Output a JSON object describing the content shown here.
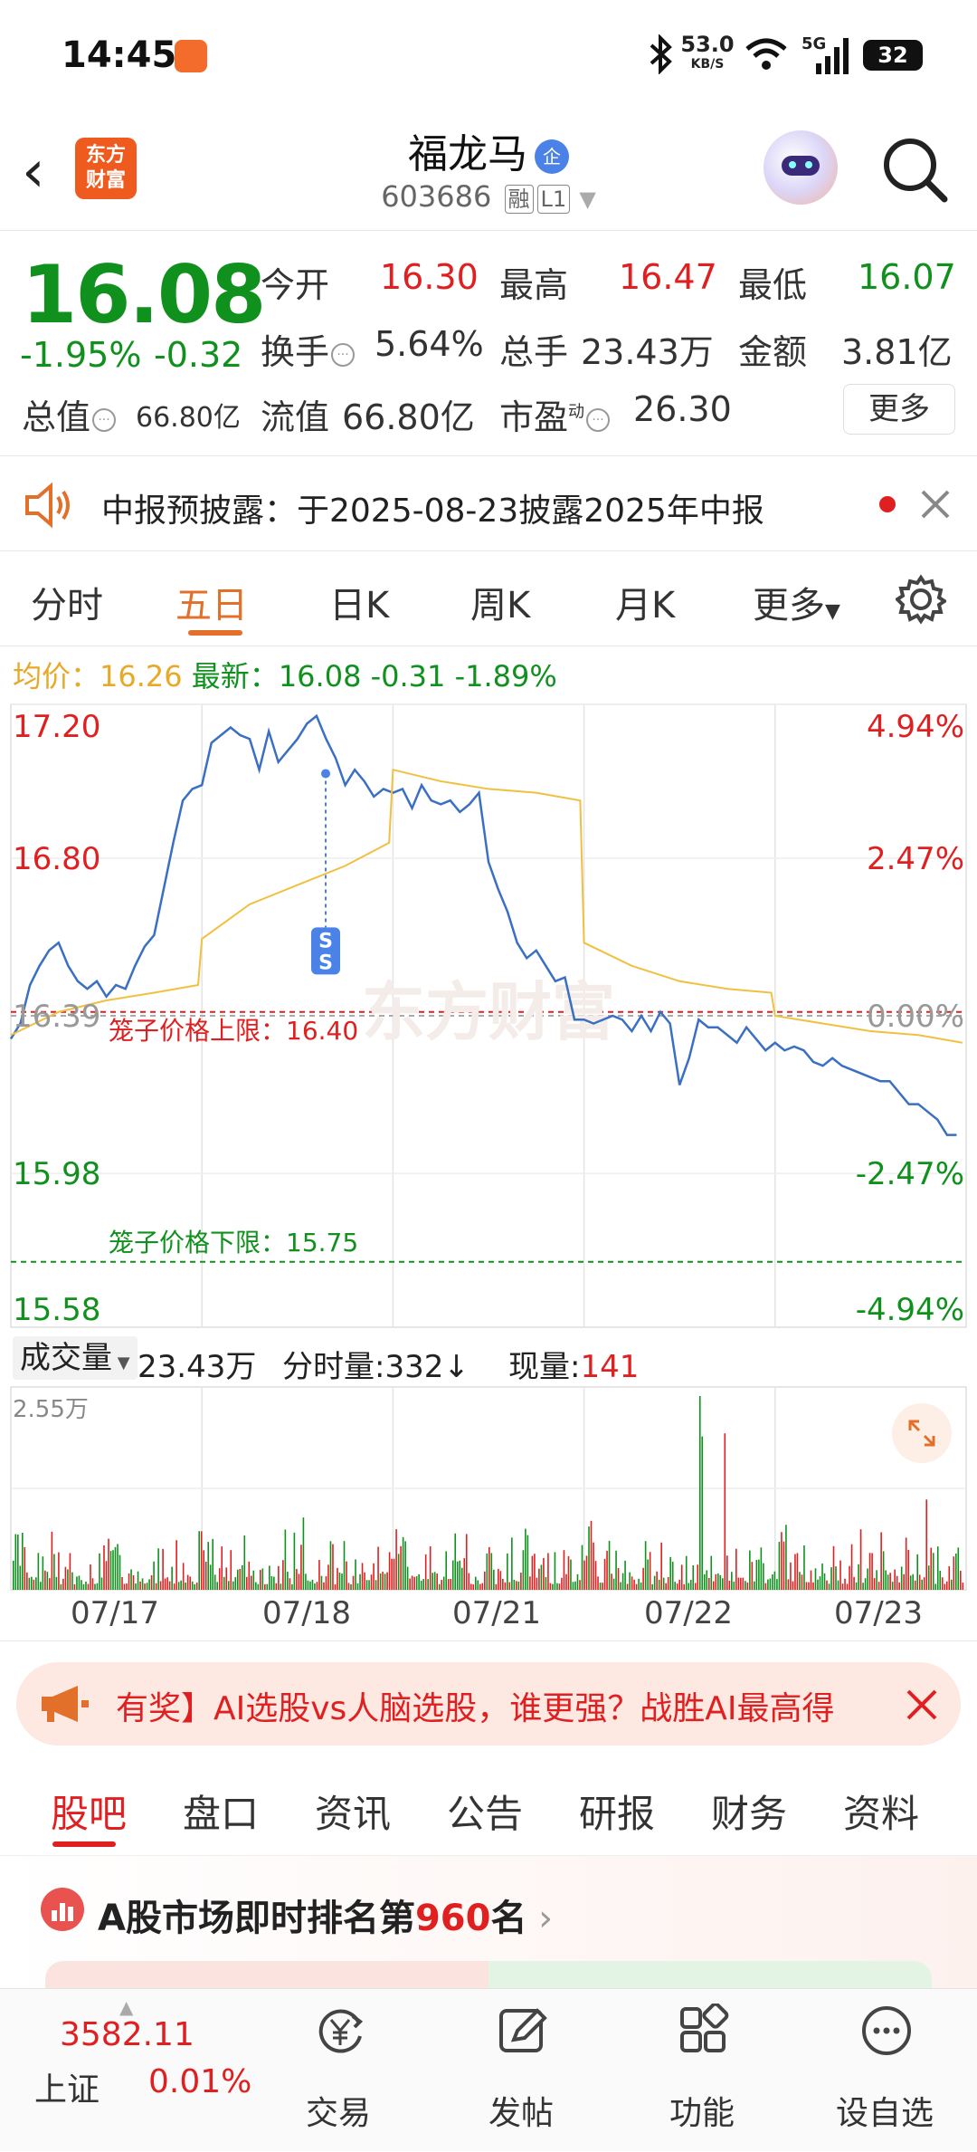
{
  "status_bar": {
    "time": "14:45",
    "net_speed_value": "53.0",
    "net_speed_unit": "KB/S",
    "network": "5G",
    "battery": "32"
  },
  "header": {
    "logo_text_line1": "东方",
    "logo_text_line2": "财富",
    "stock_name": "福龙马",
    "qi_badge": "企",
    "stock_code": "603686",
    "tag_rong": "融",
    "tag_level": "L1"
  },
  "quote": {
    "price": "16.08",
    "change_pct": "-1.95%",
    "change_amt": "-0.32",
    "open_label": "今开",
    "open_value": "16.30",
    "high_label": "最高",
    "high_value": "16.47",
    "low_label": "最低",
    "low_value": "16.07",
    "turnover_label": "换手",
    "turnover_value": "5.64%",
    "volume_label": "总手",
    "volume_value": "23.43万",
    "amount_label": "金额",
    "amount_value": "3.81亿",
    "mktcap_label": "总值",
    "mktcap_value": "66.80亿",
    "float_label": "流值",
    "float_value": "66.80亿",
    "pe_label": "市盈",
    "pe_sup": "动",
    "pe_value": "26.30",
    "more_button": "更多"
  },
  "notice": {
    "text": "中报预披露：于2025-08-23披露2025年中报"
  },
  "chart_tabs": [
    "分时",
    "五日",
    "日K",
    "周K",
    "月K",
    "更多"
  ],
  "chart_tabs_active": 1,
  "avg_line": {
    "avg_label": "均价：",
    "avg_value": "16.26",
    "latest_label": "最新：",
    "latest_value": "16.08",
    "latest_change": "-0.31",
    "latest_pct": "-1.89%"
  },
  "chart_data": {
    "type": "line",
    "title": "",
    "xlabel": "",
    "ylabel": "",
    "ylim": [
      15.58,
      17.2
    ],
    "reference_price": 16.39,
    "y_tick_labels_left": [
      "17.20",
      "16.80",
      "16.39",
      "15.98",
      "15.58"
    ],
    "y_tick_labels_right": [
      "4.94%",
      "2.47%",
      "0.00%",
      "-2.47%",
      "-4.94%"
    ],
    "x_tick_labels": [
      "07/17",
      "07/18",
      "07/21",
      "07/22",
      "07/23"
    ],
    "upper_limit_label": "笼子价格上限：16.40",
    "upper_limit_value": 16.4,
    "lower_limit_label": "笼子价格下限：15.75",
    "lower_limit_value": 15.75,
    "watermark": "东方财富",
    "series": [
      {
        "x": [
          0,
          0.05,
          0.1,
          0.15,
          0.2,
          0.25,
          0.3,
          0.35,
          0.4,
          0.45,
          0.5,
          0.55,
          0.6,
          0.65,
          0.7,
          0.75,
          0.8,
          0.85,
          0.9,
          0.95,
          1.0,
          1.05,
          1.1,
          1.15,
          1.2,
          1.25,
          1.3,
          1.35,
          1.4,
          1.45,
          1.5,
          1.55,
          1.6,
          1.65,
          1.7,
          1.75,
          1.8,
          1.85,
          1.9,
          1.95,
          2.0,
          2.05,
          2.1,
          2.15,
          2.2,
          2.25,
          2.3,
          2.35,
          2.4,
          2.45,
          2.5,
          2.55,
          2.6,
          2.65,
          2.7,
          2.75,
          2.8,
          2.85,
          2.9,
          2.95,
          3.0,
          3.05,
          3.1,
          3.15,
          3.2,
          3.25,
          3.3,
          3.35,
          3.4,
          3.45,
          3.5,
          3.55,
          3.6,
          3.65,
          3.7,
          3.75,
          3.8,
          3.85,
          3.9,
          3.95,
          4.0,
          4.05,
          4.1,
          4.15,
          4.2,
          4.25,
          4.3,
          4.35,
          4.4,
          4.45,
          4.5,
          4.55,
          4.6,
          4.65,
          4.7,
          4.75,
          4.8,
          4.85,
          4.9,
          4.95
        ],
        "values": [
          16.33,
          16.37,
          16.47,
          16.52,
          16.56,
          16.58,
          16.52,
          16.48,
          16.46,
          16.48,
          16.44,
          16.47,
          16.46,
          16.52,
          16.57,
          16.6,
          16.72,
          16.84,
          16.95,
          16.98,
          16.99,
          17.1,
          17.12,
          17.14,
          17.12,
          17.11,
          17.03,
          17.13,
          17.05,
          17.08,
          17.11,
          17.15,
          17.17,
          17.11,
          17.06,
          16.99,
          17.03,
          17.0,
          16.96,
          16.98,
          16.97,
          16.98,
          16.93,
          16.99,
          16.95,
          16.94,
          16.95,
          16.92,
          16.94,
          16.97,
          16.79,
          16.72,
          16.66,
          16.58,
          16.54,
          16.56,
          16.52,
          16.48,
          16.49,
          16.38,
          16.38,
          16.37,
          16.38,
          16.39,
          16.38,
          16.35,
          16.39,
          16.35,
          16.4,
          16.37,
          16.21,
          16.28,
          16.38,
          16.36,
          16.36,
          16.34,
          16.32,
          16.36,
          16.33,
          16.3,
          16.32,
          16.3,
          16.31,
          16.3,
          16.27,
          16.26,
          16.28,
          16.26,
          16.25,
          16.24,
          16.23,
          16.22,
          16.22,
          16.19,
          16.16,
          16.16,
          16.14,
          16.12,
          16.08,
          16.08
        ],
        "color": "#3a6fc4"
      },
      {
        "x": [
          0,
          0.25,
          0.5,
          0.75,
          0.98,
          1.0,
          1.25,
          1.5,
          1.75,
          1.98,
          2.0,
          2.25,
          2.5,
          2.75,
          2.98,
          3.0,
          3.25,
          3.5,
          3.75,
          3.98,
          4.0,
          4.25,
          4.5,
          4.75,
          4.98
        ],
        "values": [
          16.34,
          16.4,
          16.43,
          16.45,
          16.47,
          16.59,
          16.68,
          16.73,
          16.78,
          16.84,
          17.03,
          17.0,
          16.98,
          16.97,
          16.95,
          16.58,
          16.52,
          16.48,
          16.46,
          16.45,
          16.39,
          16.37,
          16.35,
          16.34,
          16.32
        ],
        "color": "#f0c040"
      }
    ]
  },
  "volume": {
    "dropdown_label": "成交量",
    "total": "23.43万",
    "tick_label": "分时量:332↓",
    "current_label": "现量:",
    "current_value": "141",
    "max_label": "2.55万"
  },
  "ad_banner": {
    "text": "有奖】AI选股vs人脑选股，谁更强？战胜AI最高得"
  },
  "sub_tabs": [
    "股吧",
    "盘口",
    "资讯",
    "公告",
    "研报",
    "财务",
    "资料"
  ],
  "sub_tabs_active": 0,
  "rank": {
    "prefix": "A股市场即时排名第",
    "number": "960",
    "suffix": "名"
  },
  "bottom_nav": {
    "index_value": "3582.11",
    "index_name": "上证",
    "index_change": "0.01%",
    "items": [
      "交易",
      "发帖",
      "功能",
      "设自选"
    ]
  },
  "colors": {
    "up": "#e02020",
    "down": "#10911e",
    "accent": "#e2702a",
    "line": "#3a6fc4",
    "avg": "#f0c040"
  }
}
